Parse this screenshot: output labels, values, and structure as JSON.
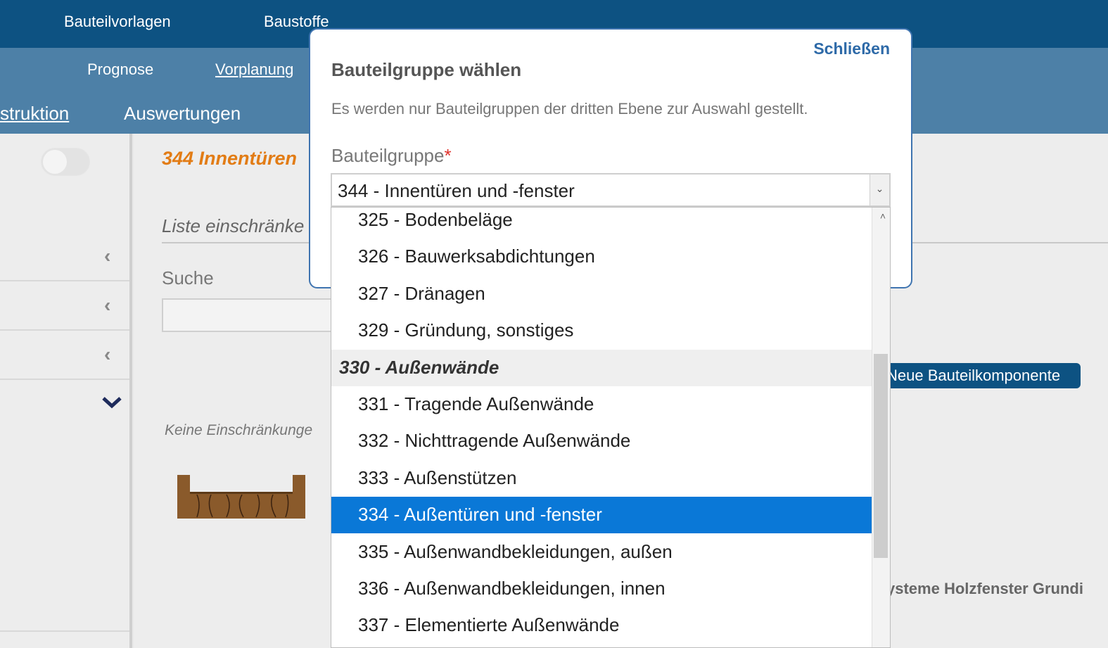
{
  "topnav": {
    "item1": "Bauteilvorlagen",
    "item2": "Baustoffe"
  },
  "subnav": {
    "prognose": "Prognose",
    "vorplanung": "Vorplanung",
    "konstruktion": "struktion",
    "auswertungen": "Auswertungen"
  },
  "main": {
    "heading": "344 Innentüren",
    "restrict_label": "Liste einschränke",
    "search_label": "Suche",
    "no_restrictions": "Keine Einschränkunge",
    "new_component_button": "Neue Bauteilkomponente",
    "right_text": "ysteme Holzfenster Grundi"
  },
  "modal": {
    "close": "Schließen",
    "title": "Bauteilgruppe wählen",
    "info": "Es werden nur Bauteilgruppen der dritten Ebene zur Auswahl gestellt.",
    "field_label": "Bauteilgruppe",
    "required_mark": "*",
    "selected_value": "344 - Innentüren und -fenster"
  },
  "dropdown": {
    "options": [
      {
        "label": "325 - Bodenbeläge",
        "kind": "option"
      },
      {
        "label": "326 - Bauwerksabdichtungen",
        "kind": "option"
      },
      {
        "label": "327 - Dränagen",
        "kind": "option"
      },
      {
        "label": "329 - Gründung, sonstiges",
        "kind": "option"
      },
      {
        "label": "330 - Außenwände",
        "kind": "group"
      },
      {
        "label": "331 - Tragende Außenwände",
        "kind": "option"
      },
      {
        "label": "332 - Nichttragende Außenwände",
        "kind": "option"
      },
      {
        "label": "333 - Außenstützen",
        "kind": "option"
      },
      {
        "label": "334 - Außentüren und -fenster",
        "kind": "highlighted"
      },
      {
        "label": "335 - Außenwandbekleidungen, außen",
        "kind": "option"
      },
      {
        "label": "336 - Außenwandbekleidungen, innen",
        "kind": "option"
      },
      {
        "label": "337 - Elementierte Außenwände",
        "kind": "option"
      }
    ]
  },
  "colors": {
    "topbar": "#0d5282",
    "subbar": "#4d80a7",
    "accent": "#e27c15",
    "highlight": "#0a78d7"
  }
}
